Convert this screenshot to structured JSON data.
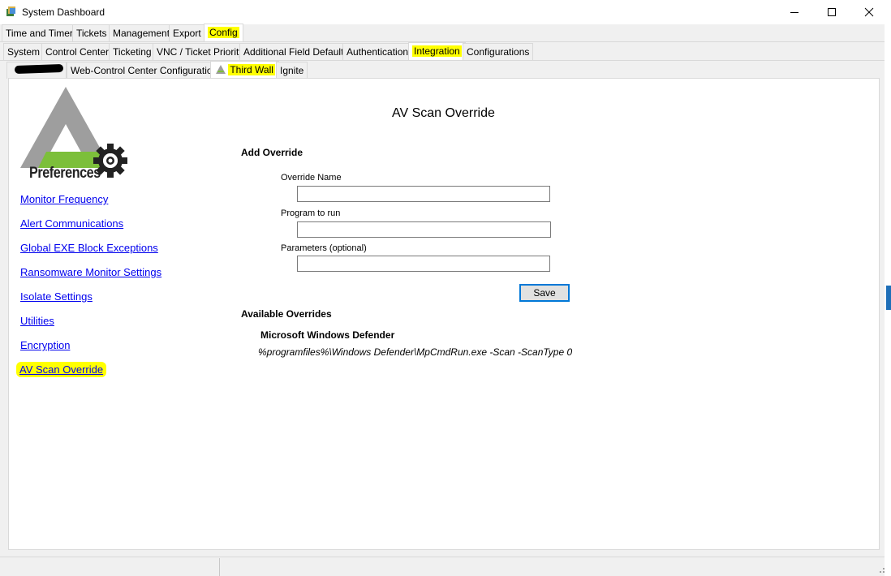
{
  "window": {
    "title": "System Dashboard",
    "controls": {
      "minimize": "—",
      "maximize": "☐",
      "close": "✕"
    }
  },
  "tabs_main": [
    {
      "label": "Time and Timers",
      "active": false
    },
    {
      "label": "Tickets",
      "active": false
    },
    {
      "label": "Management",
      "active": false
    },
    {
      "label": "Export",
      "active": false
    },
    {
      "label": "Config",
      "active": true
    }
  ],
  "tabs_config": [
    {
      "label": "System",
      "active": false
    },
    {
      "label": "Control Center",
      "active": false
    },
    {
      "label": "Ticketing",
      "active": false
    },
    {
      "label": "VNC / Ticket Priority",
      "active": false
    },
    {
      "label": "Additional Field Defaults",
      "active": false
    },
    {
      "label": "Authentication",
      "active": false
    },
    {
      "label": "Integration",
      "active": true
    },
    {
      "label": "Configurations",
      "active": false
    }
  ],
  "tabs_integration": [
    {
      "label": "",
      "active": false,
      "redacted": true
    },
    {
      "label": "Web-Control Center Configuration",
      "active": false
    },
    {
      "label": "Third Wall",
      "active": true
    },
    {
      "label": "Ignite",
      "active": false
    }
  ],
  "logo": {
    "text": "Preferences",
    "colors": {
      "triangle": "#9e9e9e",
      "band": "#7cbf3a",
      "gear": "#222222"
    }
  },
  "sidebar": {
    "links": [
      {
        "label": "Monitor Frequency",
        "active": false
      },
      {
        "label": "Alert Communications",
        "active": false
      },
      {
        "label": "Global EXE Block Exceptions",
        "active": false
      },
      {
        "label": "Ransomware Monitor Settings",
        "active": false
      },
      {
        "label": "Isolate Settings",
        "active": false
      },
      {
        "label": "Utilities",
        "active": false
      },
      {
        "label": "Encryption",
        "active": false
      },
      {
        "label": "AV Scan Override",
        "active": true
      }
    ]
  },
  "main": {
    "title": "AV Scan Override",
    "add_section": "Add Override",
    "fields": {
      "override_name": {
        "label": "Override Name",
        "value": ""
      },
      "program": {
        "label": "Program to run",
        "value": ""
      },
      "parameters": {
        "label": "Parameters (optional)",
        "value": ""
      }
    },
    "save_label": "Save",
    "available_section": "Available Overrides",
    "overrides": [
      {
        "name": "Microsoft Windows Defender",
        "command": "%programfiles%\\Windows Defender\\MpCmdRun.exe -Scan -ScanType 0"
      }
    ]
  },
  "colors": {
    "highlight": "#ffff00",
    "link": "#0000ee",
    "focus_border": "#0078d7"
  }
}
